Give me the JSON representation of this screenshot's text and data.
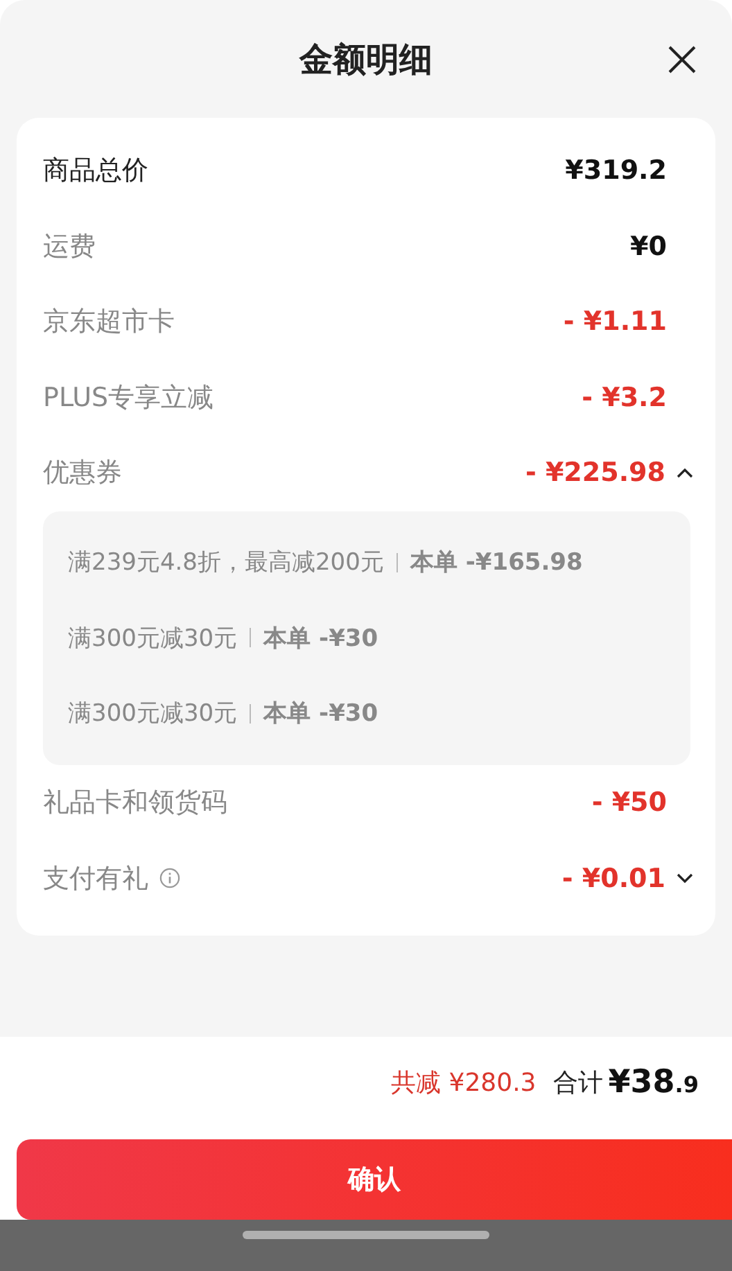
{
  "header": {
    "title": "金额明细"
  },
  "rows": [
    {
      "kind": "total",
      "label": "商品总价",
      "amount": "¥319.2"
    },
    {
      "kind": "plain",
      "label": "运费",
      "amount": "¥0"
    },
    {
      "kind": "discount",
      "label": "京东超市卡",
      "amount": "- ¥1.11"
    },
    {
      "kind": "discount",
      "label": "PLUS专享立减",
      "amount": "- ¥3.2"
    },
    {
      "kind": "discount",
      "label": "优惠券",
      "amount": "- ¥225.98",
      "expanded": true,
      "details": [
        {
          "rule": "满239元4.8折，最高减200元",
          "saving": "本单 -¥165.98"
        },
        {
          "rule": "满300元减30元",
          "saving": "本单 -¥30"
        },
        {
          "rule": "满300元减30元",
          "saving": "本单 -¥30"
        }
      ]
    },
    {
      "kind": "discount",
      "label": "礼品卡和领货码",
      "amount": "- ¥50"
    },
    {
      "kind": "discount",
      "label": "支付有礼",
      "amount": "- ¥0.01",
      "info": true,
      "expanded": false
    }
  ],
  "summary": {
    "saved": "共减 ¥280.3",
    "total_label": "合计",
    "total": "¥38.9"
  },
  "confirm_button": "确认"
}
